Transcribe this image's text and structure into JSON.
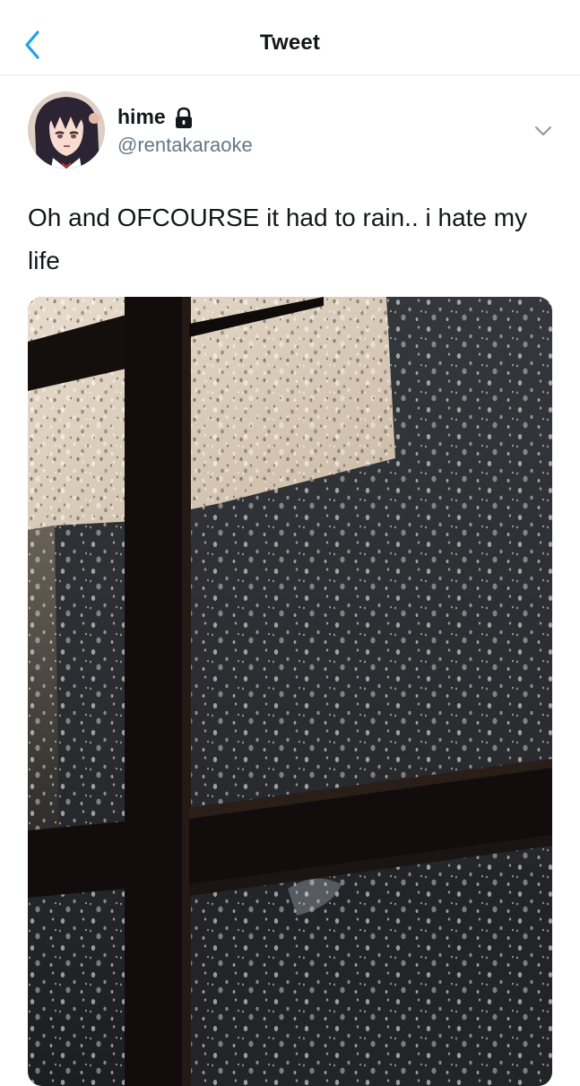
{
  "header": {
    "title": "Tweet",
    "back_icon": "chevron-left-icon",
    "accent_color": "#1da1f2"
  },
  "tweet": {
    "display_name": "hime",
    "handle": "@rentakaraoke",
    "protected_icon": "lock-icon",
    "more_icon": "chevron-down-icon",
    "text": "Oh and OFCOURSE it had to rain.. i hate my life",
    "media": {
      "description_icon": "photo",
      "subject": "rain on window at night"
    }
  }
}
